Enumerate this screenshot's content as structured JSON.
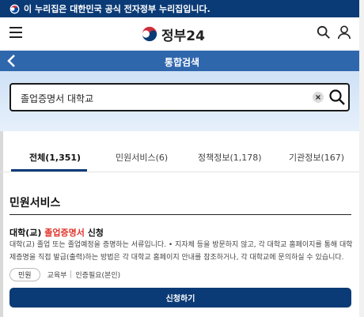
{
  "gov_banner": {
    "text": "이 누리집은 대한민국 공식 전자정부 누리집입니다."
  },
  "header": {
    "logo_text": "정부24"
  },
  "titlebar": {
    "title": "통합검색"
  },
  "search": {
    "value": "졸업증명서 대학교"
  },
  "tabs": [
    {
      "label": "전체(1,351)",
      "active": true
    },
    {
      "label": "민원서비스(6)",
      "active": false
    },
    {
      "label": "정책정보(1,178)",
      "active": false
    },
    {
      "label": "기관정보(167)",
      "active": false
    }
  ],
  "section": {
    "title": "민원서비스"
  },
  "result": {
    "title_prefix": "대학(교) ",
    "title_highlight": "졸업증명서",
    "title_suffix": " 신청",
    "description": "대학(교) 졸업 또는 졸업예정을 증명하는 서류입니다. • 지자체 등을 방문하지 않고, 각 대학교 홈페이지를 통해 대학 제증명을 직접 발급(출력)하는 방법은 각 대학교 홈페이지 안내를 참조하거나, 각 대학교에 문의하실 수 있습니다.",
    "badge": "민원",
    "org": "교육부",
    "auth": "인증필요(본인)",
    "apply_label": "신청하기"
  },
  "colors": {
    "banner": "#0b3b76",
    "titlebar": "#2f67ad",
    "highlight": "#e0362e",
    "button": "#0b3b76"
  }
}
